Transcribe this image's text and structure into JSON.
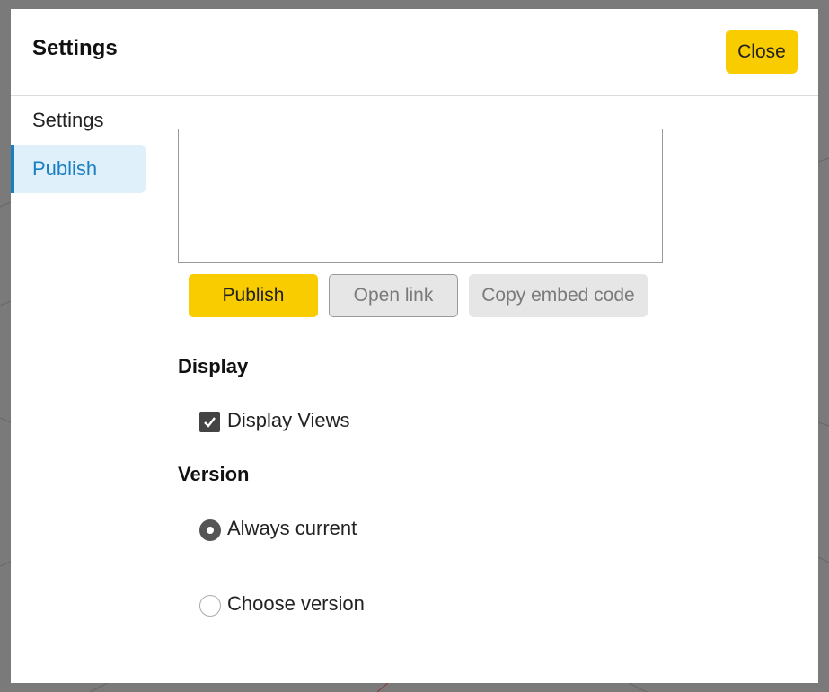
{
  "dialog": {
    "title": "Settings",
    "close_label": "Close"
  },
  "sidebar": {
    "items": [
      {
        "label": "Settings",
        "active": false
      },
      {
        "label": "Publish",
        "active": true
      }
    ]
  },
  "publish": {
    "embed_code_value": "",
    "buttons": {
      "publish_label": "Publish",
      "open_link_label": "Open link",
      "copy_embed_label": "Copy embed code"
    }
  },
  "display": {
    "heading": "Display",
    "display_views": {
      "label": "Display Views",
      "checked": true
    }
  },
  "version": {
    "heading": "Version",
    "options": [
      {
        "label": "Always current",
        "selected": true
      },
      {
        "label": "Choose version",
        "selected": false
      }
    ]
  },
  "colors": {
    "accent": "#f9cc00",
    "active_nav": "#1a7fc1",
    "active_nav_bg": "#e0f0fb",
    "disabled_bg": "#e6e6e6"
  }
}
